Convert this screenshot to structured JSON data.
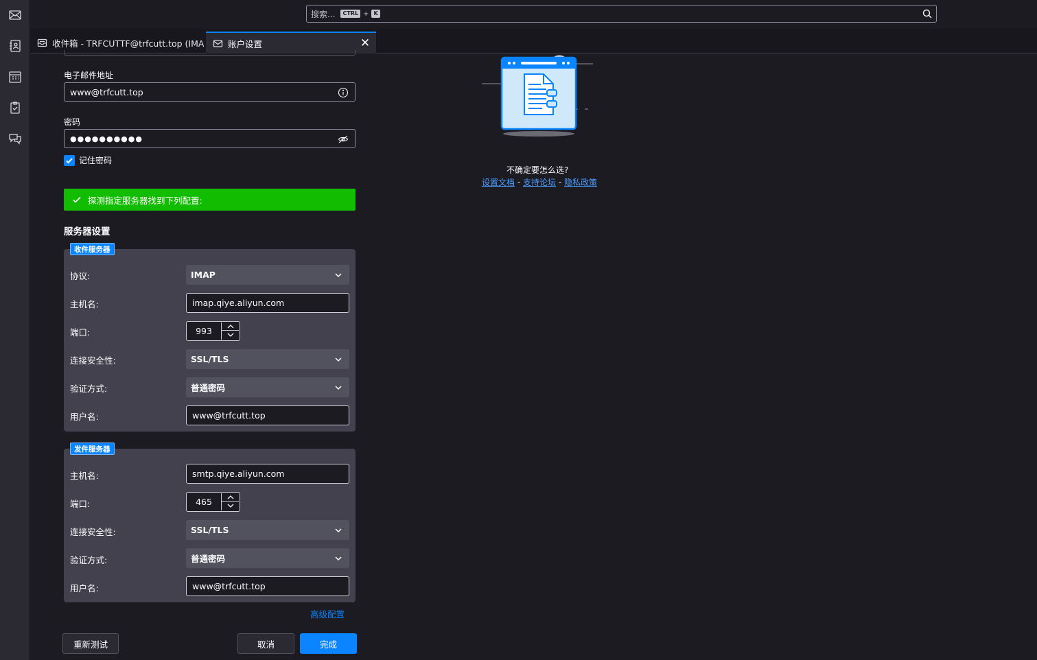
{
  "search": {
    "placeholder": "搜索...",
    "kbd_ctrl": "CTRL",
    "kbd_plus": "+",
    "kbd_key": "K"
  },
  "tabs": [
    {
      "label": "收件箱 - TRFCUTTF@trfcutt.top (IMA",
      "icon": "inbox-icon"
    },
    {
      "label": "账户设置",
      "icon": "mail-settings-icon",
      "active": true
    }
  ],
  "account": {
    "email_label": "电子邮件地址",
    "email_value": "www@trfcutt.top",
    "password_label": "密码",
    "password_value": "●●●●●●●●●●",
    "remember_label": "记住密码",
    "remember_checked": true
  },
  "success_message": "探测指定服务器找到下列配置:",
  "server_settings_title": "服务器设置",
  "incoming": {
    "legend": "收件服务器",
    "protocol_label": "协议:",
    "protocol_value": "IMAP",
    "host_label": "主机名:",
    "host_value": "imap.qiye.aliyun.com",
    "port_label": "端口:",
    "port_value": "993",
    "security_label": "连接安全性:",
    "security_value": "SSL/TLS",
    "auth_label": "验证方式:",
    "auth_value": "普通密码",
    "user_label": "用户名:",
    "user_value": "www@trfcutt.top"
  },
  "outgoing": {
    "legend": "发件服务器",
    "host_label": "主机名:",
    "host_value": "smtp.qiye.aliyun.com",
    "port_label": "端口:",
    "port_value": "465",
    "security_label": "连接安全性:",
    "security_value": "SSL/TLS",
    "auth_label": "验证方式:",
    "auth_value": "普通密码",
    "user_label": "用户名:",
    "user_value": "www@trfcutt.top"
  },
  "advanced_link": "高级配置",
  "buttons": {
    "retest": "重新测试",
    "cancel": "取消",
    "done": "完成"
  },
  "help": {
    "question": "不确定要怎么选?",
    "link_docs": "设置文档",
    "sep": " - ",
    "link_forum": "支持论坛",
    "link_privacy": "隐私政策"
  },
  "colors": {
    "accent": "#0a84ff",
    "success": "#12bc00",
    "bg": "#1c1b22",
    "panel": "#42414d"
  }
}
